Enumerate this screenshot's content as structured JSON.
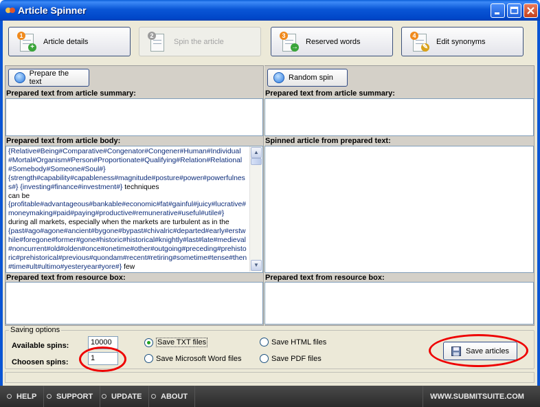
{
  "window": {
    "title": "Article Spinner"
  },
  "steps": [
    {
      "num": "1",
      "label": "Article details"
    },
    {
      "num": "2",
      "label": "Spin the article"
    },
    {
      "num": "3",
      "label": "Reserved words"
    },
    {
      "num": "4",
      "label": "Edit synonyms"
    }
  ],
  "left": {
    "prepare_button": "Prepare the text",
    "summary_label": "Prepared text from article summary:",
    "body_label": "Prepared text from article body:",
    "resource_label": "Prepared text from resource box:",
    "body_lines": [
      {
        "t": "{Relative#Being#Comparative#Congenator#Congener#Human#Individual",
        "s": true
      },
      {
        "t": "#Mortal#Organism#Person#Proportionate#Qualifying#Relation#Relational",
        "s": true
      },
      {
        "t": "#Somebody#Someone#Soul#}",
        "s": true
      },
      {
        "t": "{strength#capability#capableness#magnitude#posture#power#powerfulness#} ",
        "s": true,
        "tail": "{investing#finance#investment#}",
        "tail2": " techniques"
      },
      {
        "t": "can be",
        "s": false
      },
      {
        "t": "{profitable#advantageous#bankable#economic#fat#gainful#juicy#lucrative#moneymaking#paid#paying#productive#remunerative#useful#utile#}",
        "s": true
      },
      {
        "t": "during all markets, especially when the markets are turbulent as in the",
        "s": false
      },
      {
        "t": "{past#ago#agone#ancient#bygone#bypast#chivalric#departed#early#erstwhile#foregone#former#gone#historic#historical#knightly#last#late#medieval#noncurrent#old#olden#once#onetime#other#outgoing#preceding#prehistoric#prehistorical#previous#quondam#recent#retiring#sometime#tense#then#time#ult#ultimo#yesteryear#yore#}",
        "s": true,
        "tail2": " few"
      }
    ]
  },
  "right": {
    "random_button": "Random spin",
    "summary_label": "Prepared text from article summary:",
    "spinned_label": "Spinned article from prepared text:",
    "resource_label": "Prepared text from resource box:"
  },
  "saving": {
    "legend": "Saving options",
    "available_label": "Available spins:",
    "available_value": "10000",
    "chosen_label": "Choosen spins:",
    "chosen_value": "1",
    "opt_txt": "Save TXT files",
    "opt_word": "Save Microsoft Word files",
    "opt_html": "Save HTML files",
    "opt_pdf": "Save PDF files",
    "save_button": "Save articles"
  },
  "footer": {
    "help": "HELP",
    "support": "SUPPORT",
    "update": "UPDATE",
    "about": "ABOUT",
    "site": "WWW.SUBMITSUITE.COM"
  }
}
